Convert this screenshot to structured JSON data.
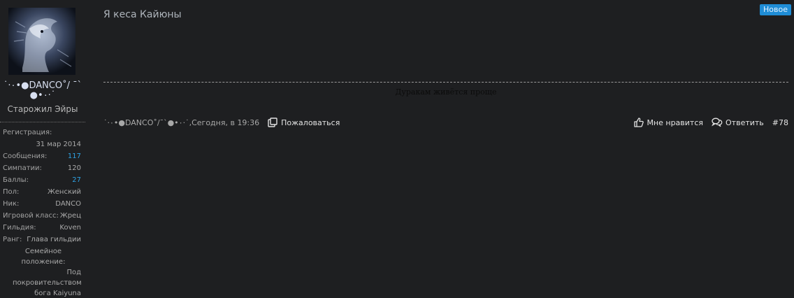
{
  "user": {
    "name": "˙·٠•●DANCO˚/ ¯`●•٠·˙",
    "title": "Старожил Эйры",
    "avatar_icon": "dragon-avatar",
    "stats": {
      "registration_label": "Регистрация:",
      "registration_value": "31 мар 2014",
      "messages_label": "Сообщения:",
      "messages_value": "117",
      "likes_label": "Симпатии:",
      "likes_value": "120",
      "points_label": "Баллы:",
      "points_value": "27",
      "gender_label": "Пол:",
      "gender_value": "Женский",
      "nick_label": "Ник:",
      "nick_value": "DANCO",
      "class_label": "Игровой класс:",
      "class_value": "Жрец",
      "guild_label": "Гильдия:",
      "guild_value": "Koven",
      "rank_label": "Ранг:",
      "rank_value": "Глава гильдии",
      "family_label": "Семейное положение:",
      "family_value": "Под покровительством бога Kaiyuna"
    }
  },
  "post": {
    "badge": "Новое",
    "text": "Я кеса Кайюны",
    "signature": "Дуракам живётся проще",
    "author": "˙·٠•●DANCO˚/¯`●•٠·˙",
    "date_sep": ", ",
    "date": "Сегодня, в 19:36",
    "report_label": "Пожаловаться",
    "like_label": "Мне нравится",
    "reply_label": "Ответить",
    "number": "#78"
  },
  "colors": {
    "background": "#1e1f21",
    "link": "#2ea2e4",
    "badge": "#1f8dd6"
  }
}
